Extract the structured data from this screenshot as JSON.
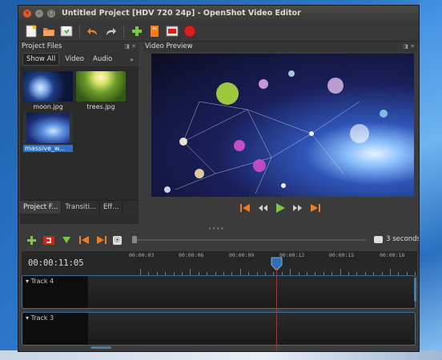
{
  "window": {
    "title": "Untitled Project [HDV 720 24p] - OpenShot Video Editor",
    "controls": {
      "close": "×",
      "minimize": "–",
      "maximize": "□"
    }
  },
  "toolbar": {
    "icons": [
      "new-project-icon",
      "open-project-icon",
      "save-project-icon",
      "undo-icon",
      "redo-icon",
      "import-files-icon",
      "profile-icon",
      "fullscreen-icon",
      "export-video-icon"
    ]
  },
  "project_files": {
    "title": "Project Files",
    "filters": [
      "Show All",
      "Video",
      "Audio"
    ],
    "more": "»",
    "files": [
      {
        "name": "moon.jpg",
        "selected": false
      },
      {
        "name": "trees.jpg",
        "selected": false
      },
      {
        "name": "massive_w...",
        "selected": true
      }
    ],
    "bottom_tabs": [
      "Project F...",
      "Transiti...",
      "Eff..."
    ]
  },
  "video_preview": {
    "title": "Video Preview",
    "transport": [
      "jump-start-icon",
      "rewind-icon",
      "play-icon",
      "fast-forward-icon",
      "jump-end-icon"
    ]
  },
  "timeline": {
    "current_time": "00:00:11:05",
    "zoom_label": "3 seconds",
    "ruler_labels": [
      "00:00:03",
      "00:00:06",
      "00:00:09",
      "00:00:12",
      "00:00:15",
      "00:00:18"
    ],
    "tracks": [
      "Track 4",
      "Track 3"
    ]
  },
  "colors": {
    "accent_green": "#7ec843",
    "accent_orange": "#f07d21",
    "record_red": "#d6201f",
    "playhead": "#d92020",
    "selection_blue": "#2f6fc4"
  }
}
